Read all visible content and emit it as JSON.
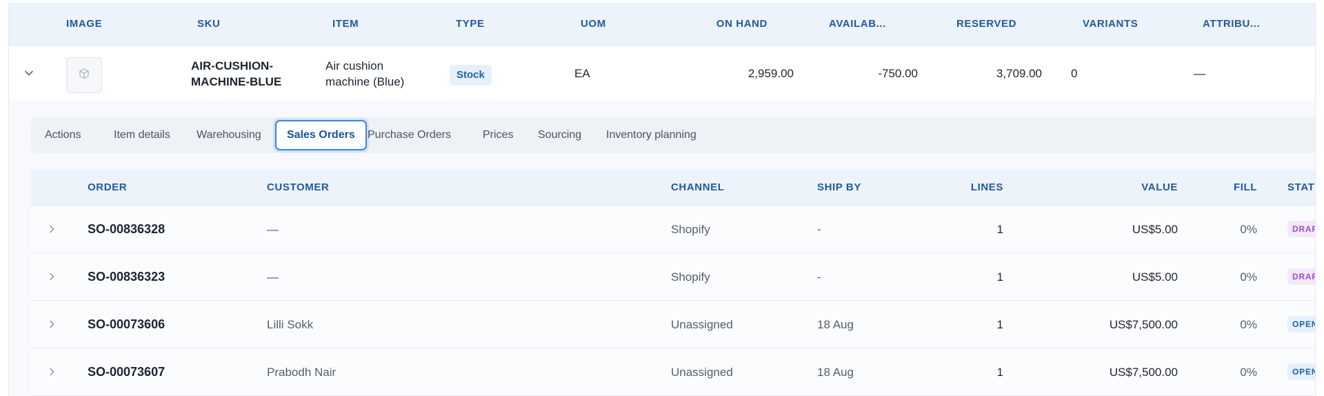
{
  "inventory_table": {
    "headers": {
      "image": "IMAGE",
      "sku": "SKU",
      "item": "ITEM",
      "type": "TYPE",
      "uom": "UOM",
      "on_hand": "ON HAND",
      "available": "AVAILAB...",
      "reserved": "RESERVED",
      "variants": "VARIANTS",
      "attributes": "ATTRIBU..."
    },
    "row": {
      "sku": "AIR-CUSHION-MACHINE-BLUE",
      "item": "Air cushion machine (Blue)",
      "type": "Stock",
      "uom": "EA",
      "on_hand": "2,959.00",
      "available": "-750.00",
      "reserved": "3,709.00",
      "variants": "0",
      "attributes": "—"
    }
  },
  "tabs": [
    {
      "label": "Actions"
    },
    {
      "label": "Item details"
    },
    {
      "label": "Warehousing"
    },
    {
      "label": "Sales Orders",
      "active": true
    },
    {
      "label": "Purchase Orders"
    },
    {
      "label": "Prices"
    },
    {
      "label": "Sourcing"
    },
    {
      "label": "Inventory planning"
    }
  ],
  "sales_orders": {
    "headers": {
      "order": "ORDER",
      "customer": "CUSTOMER",
      "channel": "CHANNEL",
      "ship_by": "SHIP BY",
      "lines": "LINES",
      "value": "VALUE",
      "fill": "FILL",
      "status": "STATU"
    },
    "rows": [
      {
        "order": "SO-00836328",
        "customer": "—",
        "channel": "Shopify",
        "ship_by": "-",
        "lines": "1",
        "value": "US$5.00",
        "fill": "0%",
        "status": "DRAF"
      },
      {
        "order": "SO-00836323",
        "customer": "—",
        "channel": "Shopify",
        "ship_by": "-",
        "lines": "1",
        "value": "US$5.00",
        "fill": "0%",
        "status": "DRAF"
      },
      {
        "order": "SO-00073606",
        "customer": "Lilli Sokk",
        "channel": "Unassigned",
        "ship_by": "18 Aug",
        "lines": "1",
        "value": "US$7,500.00",
        "fill": "0%",
        "status": "OPEN"
      },
      {
        "order": "SO-00073607",
        "customer": "Prabodh Nair",
        "channel": "Unassigned",
        "ship_by": "18 Aug",
        "lines": "1",
        "value": "US$7,500.00",
        "fill": "0%",
        "status": "OPEN"
      }
    ]
  },
  "colors": {
    "header_bg": "#edf3fb",
    "header_text": "#22589b",
    "accent": "#3d84db",
    "draft_badge": "#9b4dc9",
    "open_badge": "#1f5fa6"
  },
  "icons": {
    "expand": "chevron-down-icon",
    "row_expand": "chevron-right-icon",
    "thumbnail": "package-icon"
  }
}
